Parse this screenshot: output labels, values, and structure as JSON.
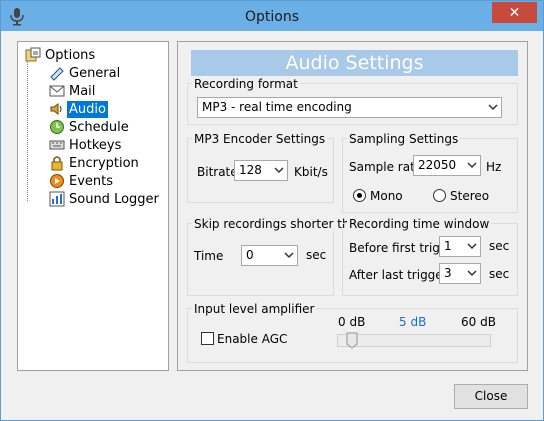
{
  "window": {
    "title": "Options"
  },
  "tree": {
    "root_label": "Options",
    "items": [
      {
        "label": "General",
        "icon": "general-icon"
      },
      {
        "label": "Mail",
        "icon": "mail-icon"
      },
      {
        "label": "Audio",
        "icon": "speaker-icon",
        "selected": true
      },
      {
        "label": "Schedule",
        "icon": "clock-icon"
      },
      {
        "label": "Hotkeys",
        "icon": "keyboard-icon"
      },
      {
        "label": "Encryption",
        "icon": "lock-icon"
      },
      {
        "label": "Events",
        "icon": "play-icon"
      },
      {
        "label": "Sound Logger",
        "icon": "chart-icon"
      }
    ]
  },
  "panel": {
    "title": "Audio Settings",
    "recording_format": {
      "label": "Recording format",
      "value": "MP3 - real time encoding"
    },
    "mp3_encoder": {
      "label": "MP3 Encoder Settings",
      "bitrate_label": "Bitrate",
      "bitrate_value": "128",
      "bitrate_unit": "Kbit/s"
    },
    "sampling": {
      "label": "Sampling Settings",
      "rate_label": "Sample rate",
      "rate_value": "22050",
      "rate_unit": "Hz",
      "mono_label": "Mono",
      "stereo_label": "Stereo",
      "selected": "Mono"
    },
    "skip": {
      "label": "Skip recordings shorter than",
      "time_label": "Time",
      "time_value": "0",
      "time_unit": "sec"
    },
    "window": {
      "label": "Recording time window",
      "before_label": "Before first trigger",
      "before_value": "1",
      "before_unit": "sec",
      "after_label": "After last trigger",
      "after_value": "3",
      "after_unit": "sec"
    },
    "amplifier": {
      "label": "Input level amplifier",
      "agc_label": "Enable AGC",
      "agc_checked": false,
      "scale_min": "0 dB",
      "scale_current": "5 dB",
      "scale_max": "60 dB",
      "level_fraction": 0.083
    }
  },
  "buttons": {
    "close_label": "Close"
  },
  "colors": {
    "accent": "#0078d7",
    "banner": "#a9c9e8",
    "current_db": "#1e6fc2"
  }
}
